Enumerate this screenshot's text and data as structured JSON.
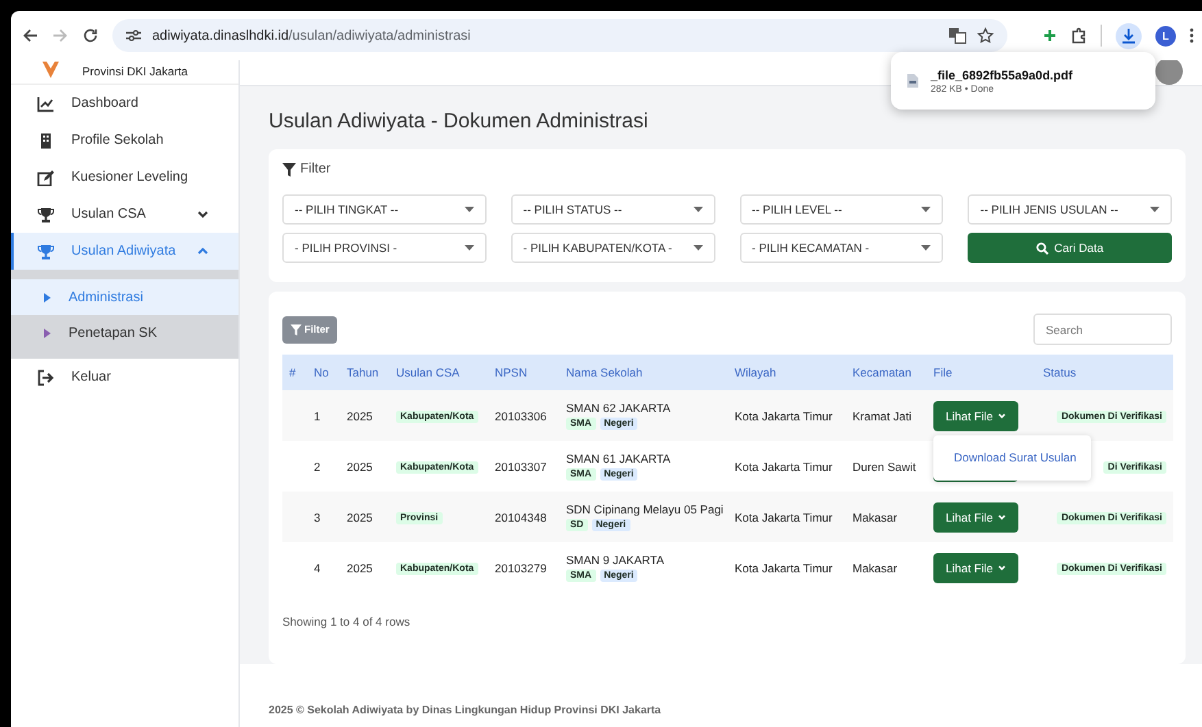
{
  "browser": {
    "url_host": "adiwiyata.dinaslhdki.id",
    "url_path": "/usulan/adiwiyata/administrasi",
    "forward_disabled": true,
    "profile_initial": "L"
  },
  "download_popup": {
    "filename": "_file_6892fb55a9a0d.pdf",
    "details": "282 KB • Done"
  },
  "sidebar": {
    "org": "Provinsi DKI Jakarta",
    "items": [
      {
        "label": "Dashboard",
        "selected": false
      },
      {
        "label": "Profile Sekolah",
        "selected": false
      },
      {
        "label": "Kuesioner Leveling",
        "selected": false
      },
      {
        "label": "Usulan CSA",
        "selected": false,
        "expanded": false
      },
      {
        "label": "Usulan Adiwiyata",
        "selected": true,
        "expanded": true,
        "children": [
          {
            "label": "Administrasi",
            "selected": true
          },
          {
            "label": "Penetapan SK",
            "selected": false
          }
        ]
      },
      {
        "label": "Keluar",
        "selected": false
      }
    ]
  },
  "page_title": "Usulan Adiwiyata - Dokumen Administrasi",
  "filter": {
    "title": "Filter",
    "selects": [
      "-- PILIH TINGKAT --",
      "-- PILIH STATUS --",
      "-- PILIH LEVEL --",
      "-- PILIH JENIS USULAN --",
      "- PILIH PROVINSI -",
      "- PILIH KABUPATEN/KOTA -",
      "- PILIH KECAMATAN -"
    ],
    "button": "Cari Data"
  },
  "table": {
    "filter_button": "Filter",
    "search": {
      "placeholder": "Search"
    },
    "columns": [
      "#",
      "No",
      "Tahun",
      "Usulan CSA",
      "NPSN",
      "Nama Sekolah",
      "Wilayah",
      "Kecamatan",
      "File",
      "Status"
    ],
    "rows": [
      {
        "no": "1",
        "tahun": "2025",
        "usulan_csa": "Kabupaten/Kota",
        "npsn": "20103306",
        "nama": "SMAN 62 JAKARTA",
        "jenjang": "SMA",
        "status_sekolah": "Negeri",
        "wilayah": "Kota Jakarta Timur",
        "kecamatan": "Kramat Jati",
        "file_button": "Lihat File",
        "menu": [
          "Download Surat Usulan"
        ],
        "status": "Dokumen Di Verifikasi"
      },
      {
        "no": "2",
        "tahun": "2025",
        "usulan_csa": "Kabupaten/Kota",
        "npsn": "20103307",
        "nama": "SMAN 61 JAKARTA",
        "jenjang": "SMA",
        "status_sekolah": "Negeri",
        "wilayah": "Kota Jakarta Timur",
        "kecamatan": "Duren Sawit",
        "status": "Di Verifikasi"
      },
      {
        "no": "3",
        "tahun": "2025",
        "usulan_csa": "Provinsi",
        "npsn": "20104348",
        "nama": "SDN Cipinang Melayu 05 Pagi",
        "jenjang": "SD",
        "status_sekolah": "Negeri",
        "wilayah": "Kota Jakarta Timur",
        "kecamatan": "Makasar",
        "file_button": "Lihat File",
        "status": "Dokumen Di Verifikasi"
      },
      {
        "no": "4",
        "tahun": "2025",
        "usulan_csa": "Kabupaten/Kota",
        "npsn": "20103279",
        "nama": "SMAN 9 JAKARTA",
        "jenjang": "SMA",
        "status_sekolah": "Negeri",
        "wilayah": "Kota Jakarta Timur",
        "kecamatan": "Makasar",
        "file_button": "Lihat File",
        "status": "Dokumen Di Verifikasi"
      }
    ],
    "summary": "Showing 1 to 4 of 4 rows"
  },
  "footer": "2025 © Sekolah Adiwiyata by Dinas Lingkungan Hidup Provinsi DKI Jakarta"
}
